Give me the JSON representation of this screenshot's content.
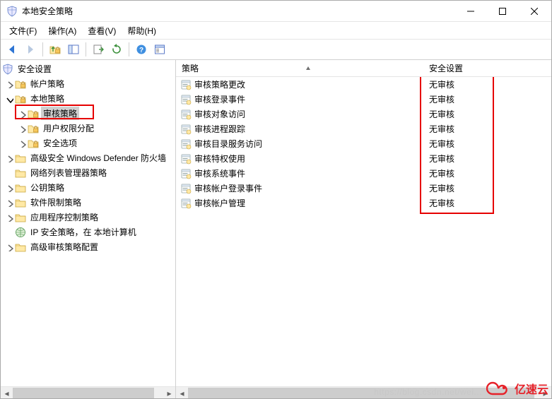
{
  "window": {
    "title": "本地安全策略"
  },
  "menu": {
    "file": "文件(F)",
    "action": "操作(A)",
    "view": "查看(V)",
    "help": "帮助(H)"
  },
  "tree": {
    "root": "安全设置",
    "items": [
      {
        "label": "帐户策略"
      },
      {
        "label": "本地策略"
      },
      {
        "label": "审核策略"
      },
      {
        "label": "用户权限分配"
      },
      {
        "label": "安全选项"
      },
      {
        "label": "高级安全 Windows Defender 防火墙"
      },
      {
        "label": "网络列表管理器策略"
      },
      {
        "label": "公钥策略"
      },
      {
        "label": "软件限制策略"
      },
      {
        "label": "应用程序控制策略"
      },
      {
        "label": "IP 安全策略，在 本地计算机"
      },
      {
        "label": "高级审核策略配置"
      }
    ]
  },
  "list": {
    "headers": {
      "policy": "策略",
      "setting": "安全设置"
    },
    "rows": [
      {
        "policy": "审核策略更改",
        "setting": "无审核"
      },
      {
        "policy": "审核登录事件",
        "setting": "无审核"
      },
      {
        "policy": "审核对象访问",
        "setting": "无审核"
      },
      {
        "policy": "审核进程跟踪",
        "setting": "无审核"
      },
      {
        "policy": "审核目录服务访问",
        "setting": "无审核"
      },
      {
        "policy": "审核特权使用",
        "setting": "无审核"
      },
      {
        "policy": "审核系统事件",
        "setting": "无审核"
      },
      {
        "policy": "审核帐户登录事件",
        "setting": "无审核"
      },
      {
        "policy": "审核帐户管理",
        "setting": "无审核"
      }
    ]
  },
  "watermark": {
    "url": "https://blog.csdn.net/wei...",
    "brand": "亿速云"
  }
}
